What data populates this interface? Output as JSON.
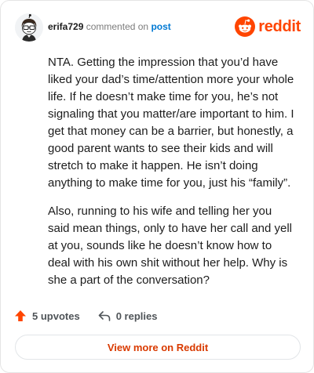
{
  "header": {
    "username": "erifa729",
    "action_text": "commented on",
    "target_link": "post"
  },
  "brand": {
    "name": "reddit",
    "color": "#ff4500"
  },
  "comment": {
    "paragraphs": [
      "NTA. Getting the impression that you’d have liked your dad’s time/attention more your whole life. If he doesn’t make time for you, he’s not signaling that you matter/are important to him. I get that money can be a barrier, but honestly, a good parent wants to see their kids and will stretch to make it happen. He isn’t doing anything to make time for you, just his “family”.",
      "Also, running to his wife and telling her you said mean things, only to have her call and yell at you, sounds like he doesn’t know how to deal with his own shit without her help. Why is she a part of the conversation?"
    ]
  },
  "actions": {
    "upvotes_label": "5 upvotes",
    "replies_label": "0 replies",
    "upvote_icon": "upvote-arrow-icon",
    "reply_icon": "reply-arrow-icon"
  },
  "footer": {
    "view_more_label": "View more on Reddit"
  },
  "colors": {
    "accent": "#ff4500",
    "link": "#0079d3",
    "button_text": "#d93a00"
  }
}
